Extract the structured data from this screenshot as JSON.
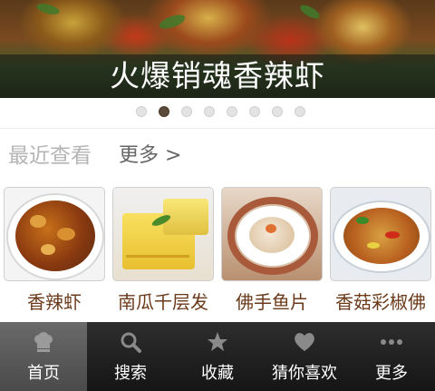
{
  "banner": {
    "title": "火爆销魂香辣虾",
    "page_count": 8,
    "active_page": 2
  },
  "recent": {
    "title": "最近查看",
    "more_label": "更多 >",
    "items": [
      {
        "label": "香辣虾"
      },
      {
        "label": "南瓜千层发"
      },
      {
        "label": "佛手鱼片"
      },
      {
        "label": "香菇彩椒佛"
      }
    ]
  },
  "tabbar": {
    "active": "home",
    "tabs": [
      {
        "label": "首页",
        "icon": "chef-hat-icon"
      },
      {
        "label": "搜索",
        "icon": "search-icon"
      },
      {
        "label": "收藏",
        "icon": "star-icon"
      },
      {
        "label": "猜你喜欢",
        "icon": "heart-icon"
      },
      {
        "label": "更多",
        "icon": "more-dots-icon"
      }
    ]
  },
  "colors": {
    "section_title": "#b5b5b5",
    "card_label": "#6b3a1a",
    "tabbar_bg": "#1f1f1f",
    "tab_active_bg": "#5a5a5a",
    "tab_icon": "#9a9a9a"
  }
}
